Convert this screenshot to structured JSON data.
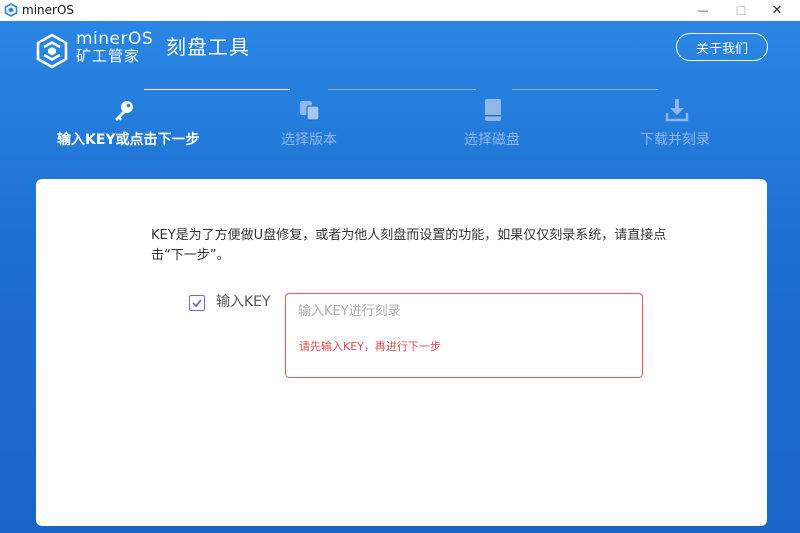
{
  "window": {
    "title": "minerOS",
    "minimize_glyph": "—",
    "maximize_glyph": "☐",
    "close_glyph": "✕"
  },
  "header": {
    "brand_en": "minerOS",
    "brand_cn": "矿工管家",
    "app_title": "刻盘工具",
    "about_label": "关于我们"
  },
  "steps": [
    {
      "label": "输入KEY或点击下一步",
      "icon": "key-icon",
      "active": true
    },
    {
      "label": "选择版本",
      "icon": "copy-icon",
      "active": false
    },
    {
      "label": "选择磁盘",
      "icon": "disk-icon",
      "active": false
    },
    {
      "label": "下载并刻录",
      "icon": "download-icon",
      "active": false
    }
  ],
  "main": {
    "description": "KEY是为了方便做U盘修复，或者为他人刻盘而设置的功能，如果仅仅刻录系统，请直接点击“下一步”。",
    "key_checkbox_label": "输入KEY",
    "key_checked": true,
    "key_input_placeholder": "输入KEY进行刻录",
    "key_input_value": "",
    "error_message": "请先输入KEY，再进行下一步"
  },
  "colors": {
    "header_blue": "#1d6fd0",
    "active_step": "#ffffff",
    "inactive_step": "#8fb8e8",
    "error_red": "#e64a4a",
    "checkbox_purple": "#6a6fc9"
  }
}
